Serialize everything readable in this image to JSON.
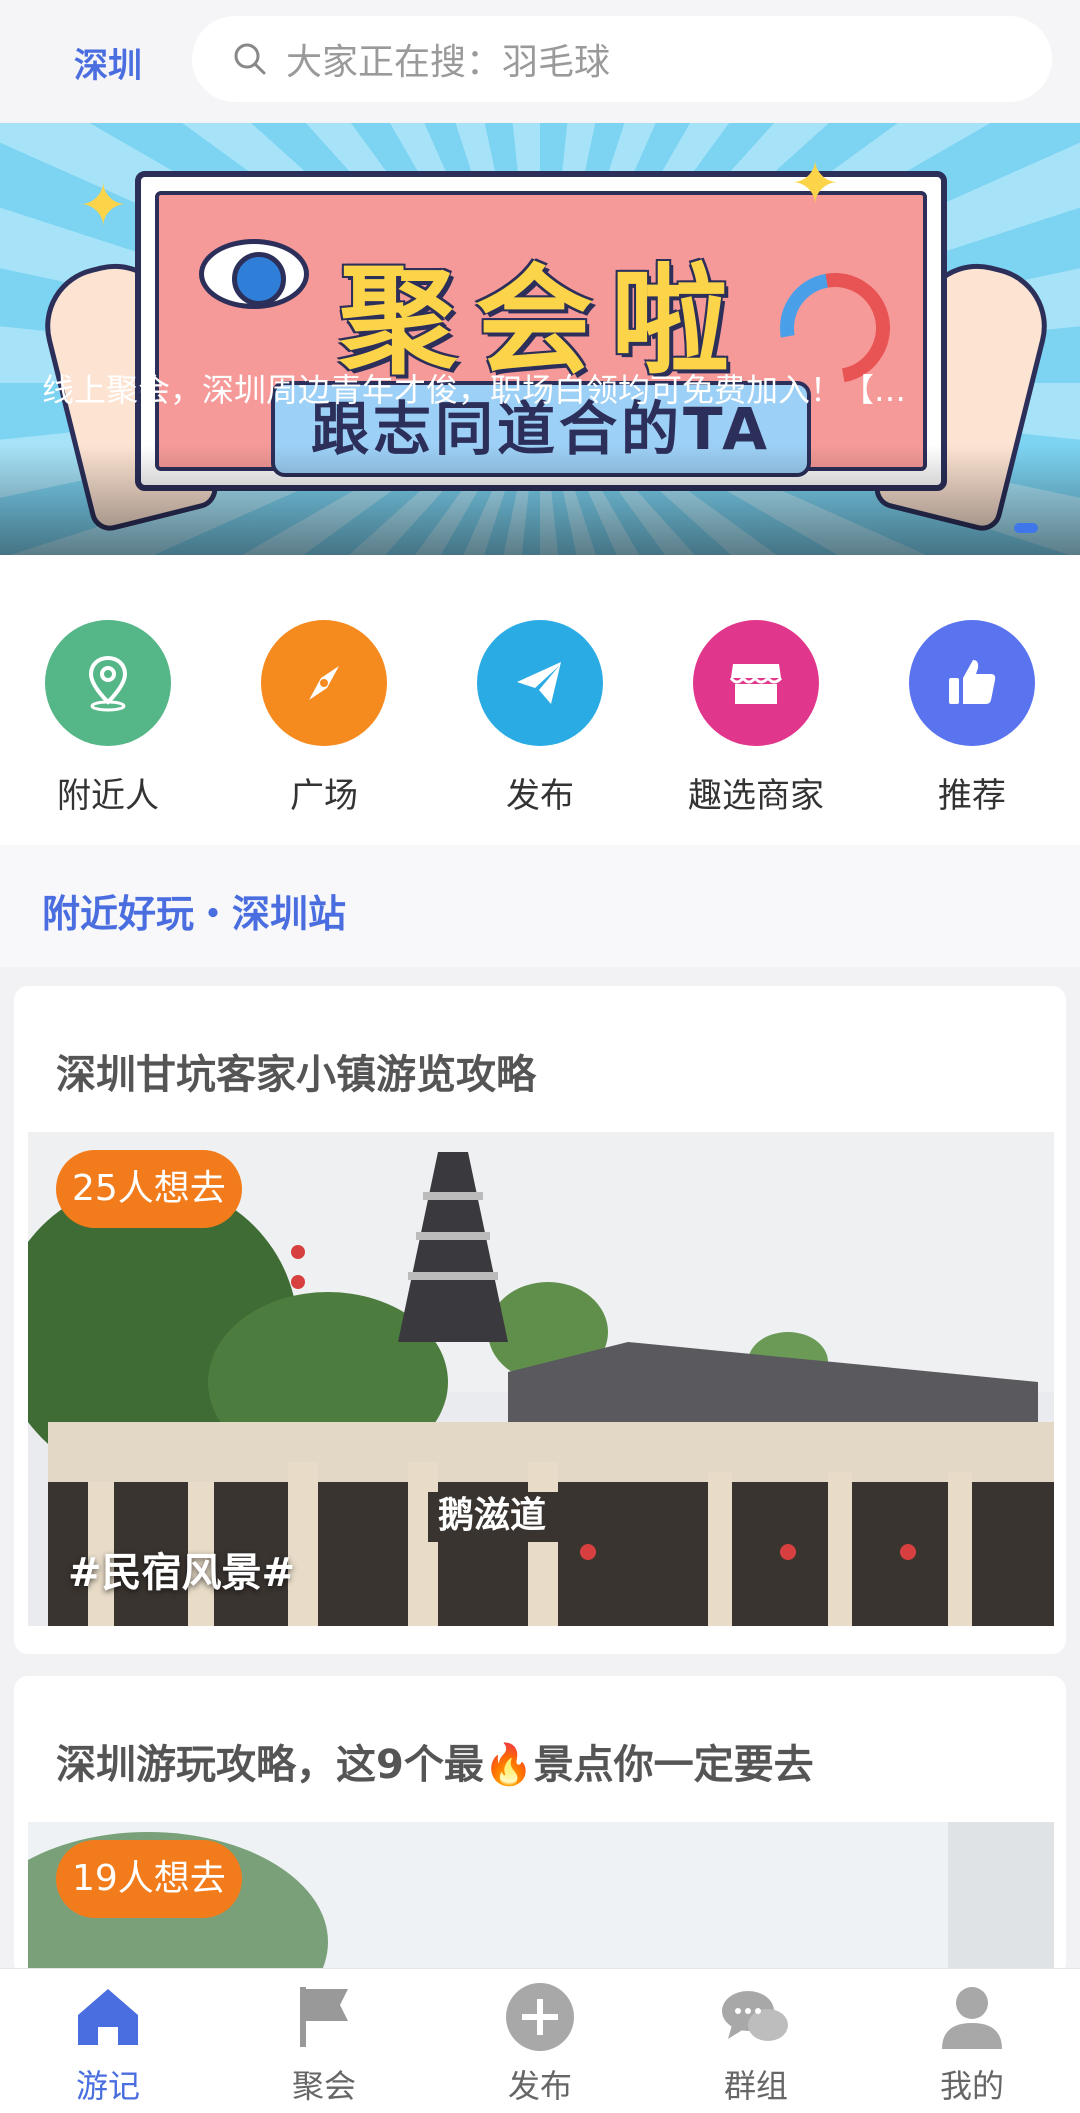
{
  "header": {
    "city": "深圳",
    "search_placeholder": "大家正在搜：羽毛球"
  },
  "banner": {
    "title": "聚会啦",
    "subtitle": "跟志同道合的TA",
    "caption": "线上聚会，深圳周边青年才俊，职场白领均可免费加入！【…"
  },
  "quicknav": [
    {
      "label": "附近人",
      "icon": "location-pin-icon",
      "color": "#55b688"
    },
    {
      "label": "广场",
      "icon": "compass-icon",
      "color": "#f58a1f"
    },
    {
      "label": "发布",
      "icon": "paper-plane-icon",
      "color": "#2aabe4"
    },
    {
      "label": "趣选商家",
      "icon": "shop-icon",
      "color": "#e0368c"
    },
    {
      "label": "推荐",
      "icon": "thumbs-up-icon",
      "color": "#5a73ef"
    }
  ],
  "section": {
    "title": "附近好玩・深圳站"
  },
  "cards": [
    {
      "title": "深圳甘坑客家小镇游览攻略",
      "badge": "25人想去",
      "tag": "#民宿风景#"
    },
    {
      "title": "深圳游玩攻略，这9个最🔥景点你一定要去",
      "badge": "19人想去"
    }
  ],
  "tabbar": [
    {
      "label": "游记",
      "icon": "home-icon",
      "active": true
    },
    {
      "label": "聚会",
      "icon": "flag-icon",
      "active": false
    },
    {
      "label": "发布",
      "icon": "plus-circle-icon",
      "active": false
    },
    {
      "label": "群组",
      "icon": "chat-bubbles-icon",
      "active": false
    },
    {
      "label": "我的",
      "icon": "user-icon",
      "active": false
    }
  ],
  "colors": {
    "accent": "#4a6ee0",
    "badge": "#f27c1c"
  }
}
